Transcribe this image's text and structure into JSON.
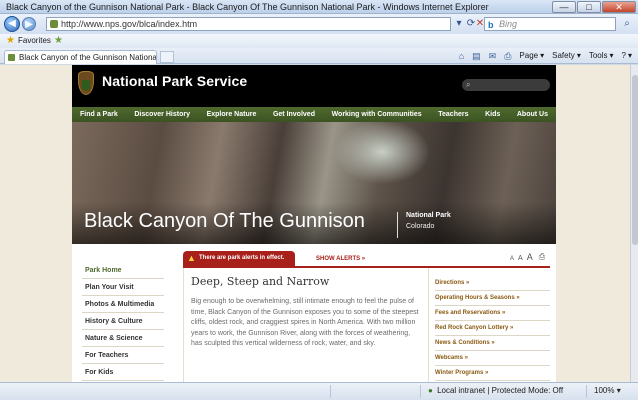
{
  "window": {
    "title": "Black Canyon of the Gunnison National Park - Black Canyon Of The Gunnison National Park - Windows Internet Explorer",
    "buttons": [
      "—",
      "□",
      "✕"
    ]
  },
  "address_bar": {
    "url": "http://www.nps.gov/blca/index.htm",
    "search_placeholder": "Bing"
  },
  "favorites_bar": {
    "label": "Favorites"
  },
  "tabs": [
    {
      "label": "Black Canyon of the Gunnison National Park - Bl..."
    }
  ],
  "command_bar": {
    "page": "Page",
    "safety": "Safety",
    "tools": "Tools",
    "help": "?"
  },
  "header": {
    "title": "National Park Service"
  },
  "nav": {
    "items": [
      "Find a Park",
      "Discover History",
      "Explore Nature",
      "Get Involved",
      "Working with Communities",
      "Teachers",
      "Kids",
      "About Us"
    ]
  },
  "hero": {
    "park_name": "Black Canyon Of The Gunnison",
    "designation": "National Park",
    "state": "Colorado"
  },
  "alerts": {
    "label": "There are park alerts in effect.",
    "show": "SHOW ALERTS »"
  },
  "font_size_labels": [
    "A",
    "A",
    "A"
  ],
  "sidenav": {
    "items": [
      "Park Home",
      "Plan Your Visit",
      "Photos & Multimedia",
      "History & Culture",
      "Nature & Science",
      "For Teachers",
      "For Kids"
    ]
  },
  "article": {
    "title": "Deep, Steep and Narrow",
    "body": "Big enough to be overwhelming, still intimate enough to feel the pulse of time, Black Canyon of the Gunnison exposes you to some of the steepest cliffs, oldest rock, and craggiest spires in North America. With two million years to work, the Gunnison River, along with the forces of weathering, has sculpted this vertical wilderness of rock, water, and sky."
  },
  "quicklinks": {
    "items": [
      "Directions »",
      "Operating Hours & Seasons »",
      "Fees and Reservations »",
      "Red Rock Canyon Lottery »",
      "News & Conditions »",
      "Webcams »",
      "Winter Programs »"
    ]
  },
  "status_bar": {
    "zone": "Local intranet | Protected Mode: Off",
    "zoom": "100%"
  },
  "colors": {
    "nav_green": "#4f6a2e",
    "alert_red": "#a8201a",
    "link_brown": "#8a5a12"
  }
}
